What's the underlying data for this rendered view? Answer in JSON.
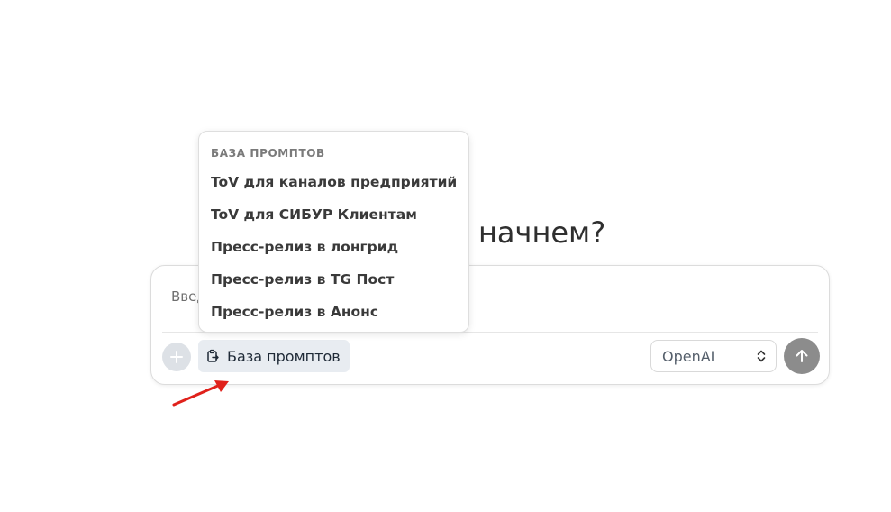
{
  "headline": "начнем?",
  "composer": {
    "placeholder": "Введите ваш запрос",
    "prompts_button_label": "База промптов",
    "model_selected": "OpenAI"
  },
  "prompt_menu": {
    "header": "БАЗА ПРОМПТОВ",
    "items": [
      "ToV для каналов предприятий",
      "ToV для СИБУР Клиентам",
      "Пресс-релиз в лонгрид",
      "Пресс-релиз в TG Пост",
      "Пресс-релиз в Анонс"
    ]
  },
  "icons": {
    "attach": "plus-icon",
    "prompts": "clipboard-arrow-icon",
    "select": "chevron-up-down-icon",
    "send": "arrow-up-icon",
    "annotation": "red-arrow-icon"
  },
  "colors": {
    "send_button": "#8c8c8c",
    "prompts_button_bg": "#e8ecf1",
    "annotation_arrow": "#e0211b"
  }
}
